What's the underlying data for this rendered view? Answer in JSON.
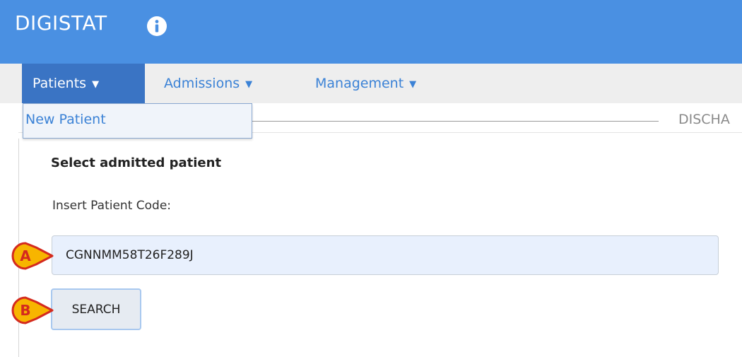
{
  "app": {
    "title": "DIGISTAT",
    "info_icon": "info-icon"
  },
  "menu": {
    "items": [
      {
        "label": "Patients",
        "caret": "▼",
        "active": true
      },
      {
        "label": "Admissions",
        "caret": "▼",
        "active": false
      },
      {
        "label": "Management",
        "caret": "▼",
        "active": false
      }
    ],
    "dropdown": {
      "items": [
        {
          "label": "New Patient"
        }
      ]
    }
  },
  "tabs": {
    "discharge_label": "DISCHA"
  },
  "form": {
    "section_title": "Select admitted patient",
    "code_label": "Insert Patient Code:",
    "code_value": "CGNNMM58T26F289J",
    "search_label": "SEARCH"
  },
  "callouts": [
    {
      "letter": "A"
    },
    {
      "letter": "B"
    }
  ],
  "colors": {
    "header_blue": "#4a90e2",
    "menu_active": "#3a74c4",
    "link_blue": "#3b82d6",
    "input_bg": "#e8f0fd",
    "callout_fill": "#f7b500",
    "callout_border": "#d42a1e"
  }
}
